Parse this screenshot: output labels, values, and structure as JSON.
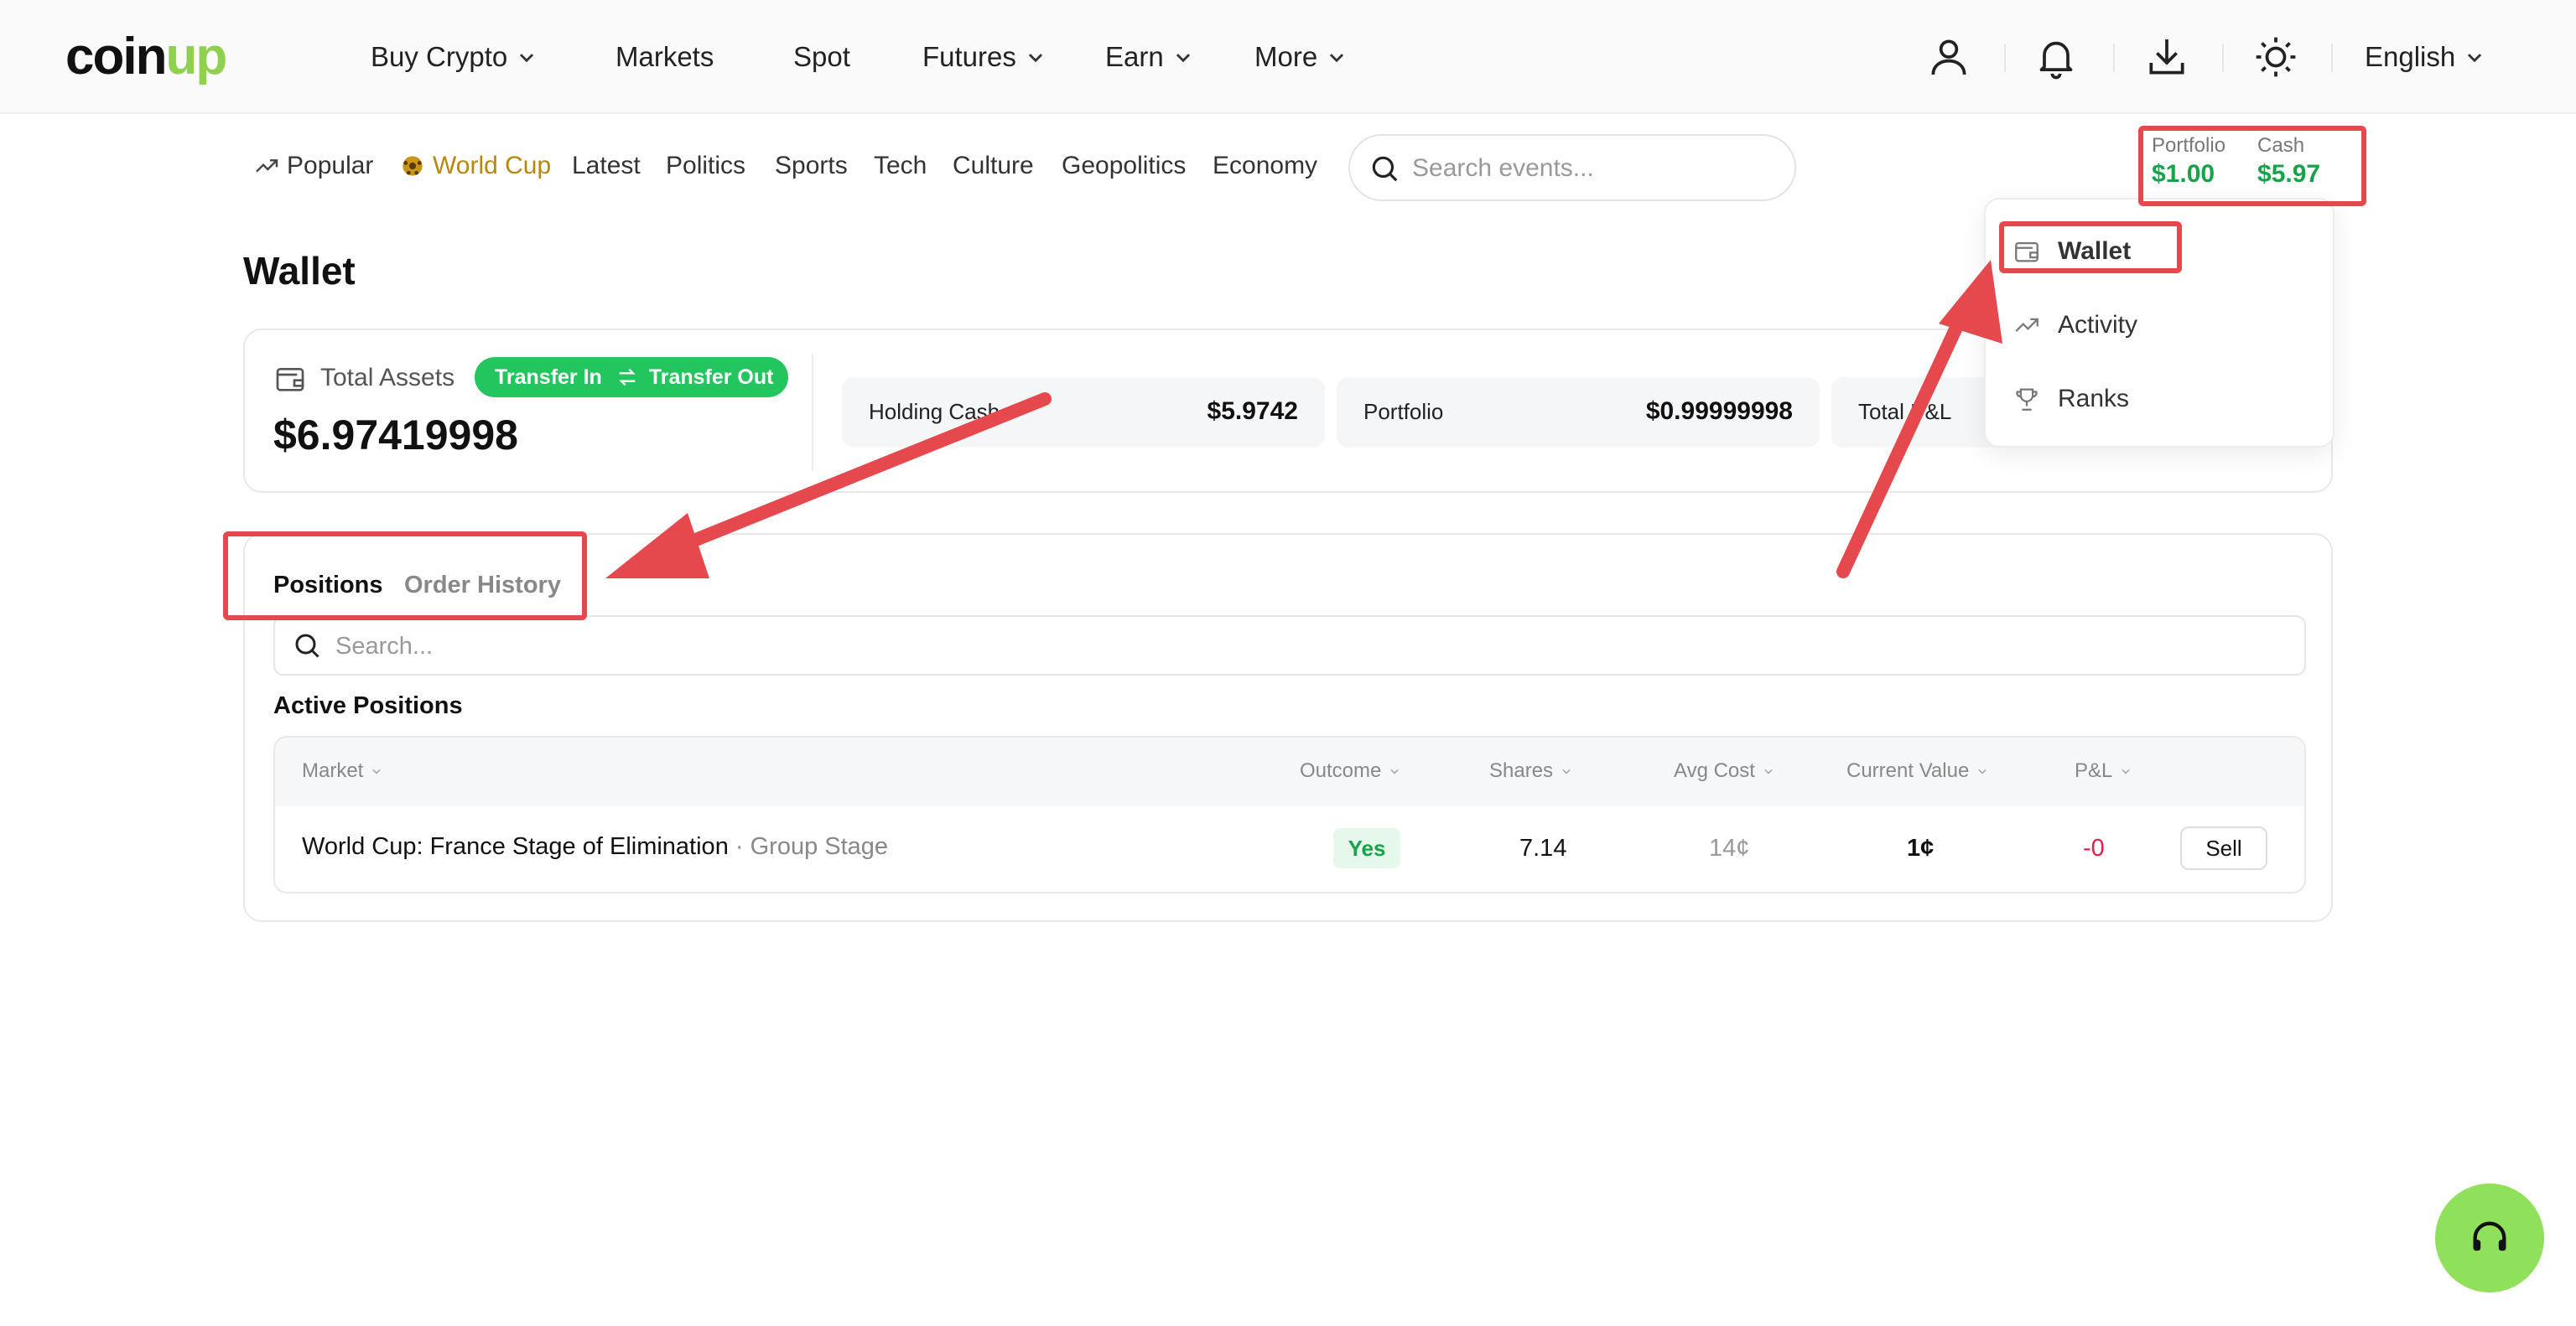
{
  "brand": {
    "logo_part1": "coin",
    "logo_part2": "up"
  },
  "topnav": {
    "items": [
      {
        "label": "Buy Crypto",
        "dropdown": true
      },
      {
        "label": "Markets",
        "dropdown": false
      },
      {
        "label": "Spot",
        "dropdown": false
      },
      {
        "label": "Futures",
        "dropdown": true
      },
      {
        "label": "Earn",
        "dropdown": true
      },
      {
        "label": "More",
        "dropdown": true
      }
    ],
    "icons": [
      "user-icon",
      "bell-icon",
      "download-icon",
      "theme-sun-icon"
    ],
    "language": "English"
  },
  "categories": {
    "items": [
      "Popular",
      "World Cup",
      "Latest",
      "Politics",
      "Sports",
      "Tech",
      "Culture",
      "Geopolitics",
      "Economy"
    ],
    "active": "World Cup",
    "active_color": "#b8860b"
  },
  "search_events": {
    "placeholder": "Search events..."
  },
  "balance": {
    "portfolio_label": "Portfolio",
    "portfolio_value": "$1.00",
    "cash_label": "Cash",
    "cash_value": "$5.97"
  },
  "dropdown_menu": {
    "items": [
      {
        "label": "Wallet",
        "icon": "wallet-icon"
      },
      {
        "label": "Activity",
        "icon": "trend-icon"
      },
      {
        "label": "Ranks",
        "icon": "trophy-icon"
      }
    ]
  },
  "page": {
    "title": "Wallet"
  },
  "assets": {
    "total_label": "Total Assets",
    "transfer_in": "Transfer In",
    "transfer_out": "Transfer Out",
    "total_value": "$6.97419998",
    "stats": [
      {
        "label": "Holding Cash",
        "value": "$5.9742"
      },
      {
        "label": "Portfolio",
        "value": "$0.99999998"
      },
      {
        "label": "Total P&L",
        "value": ""
      }
    ]
  },
  "positions": {
    "tabs": [
      "Positions",
      "Order History"
    ],
    "active_tab": "Positions",
    "search_placeholder": "Search...",
    "section_title": "Active Positions",
    "columns": [
      "Market",
      "Outcome",
      "Shares",
      "Avg Cost",
      "Current Value",
      "P&L"
    ],
    "rows": [
      {
        "market": "World Cup: France Stage of Elimination",
        "stage": "· Group Stage",
        "outcome": "Yes",
        "shares": "7.14",
        "avg_cost": "14¢",
        "current_value": "1¢",
        "pnl": "-0",
        "action": "Sell"
      }
    ]
  },
  "colors": {
    "accent_green": "#22c55e",
    "positive": "#16a34a",
    "negative": "#e11d48",
    "annotation_red": "#e5484d",
    "support_button": "#8fe05a"
  }
}
